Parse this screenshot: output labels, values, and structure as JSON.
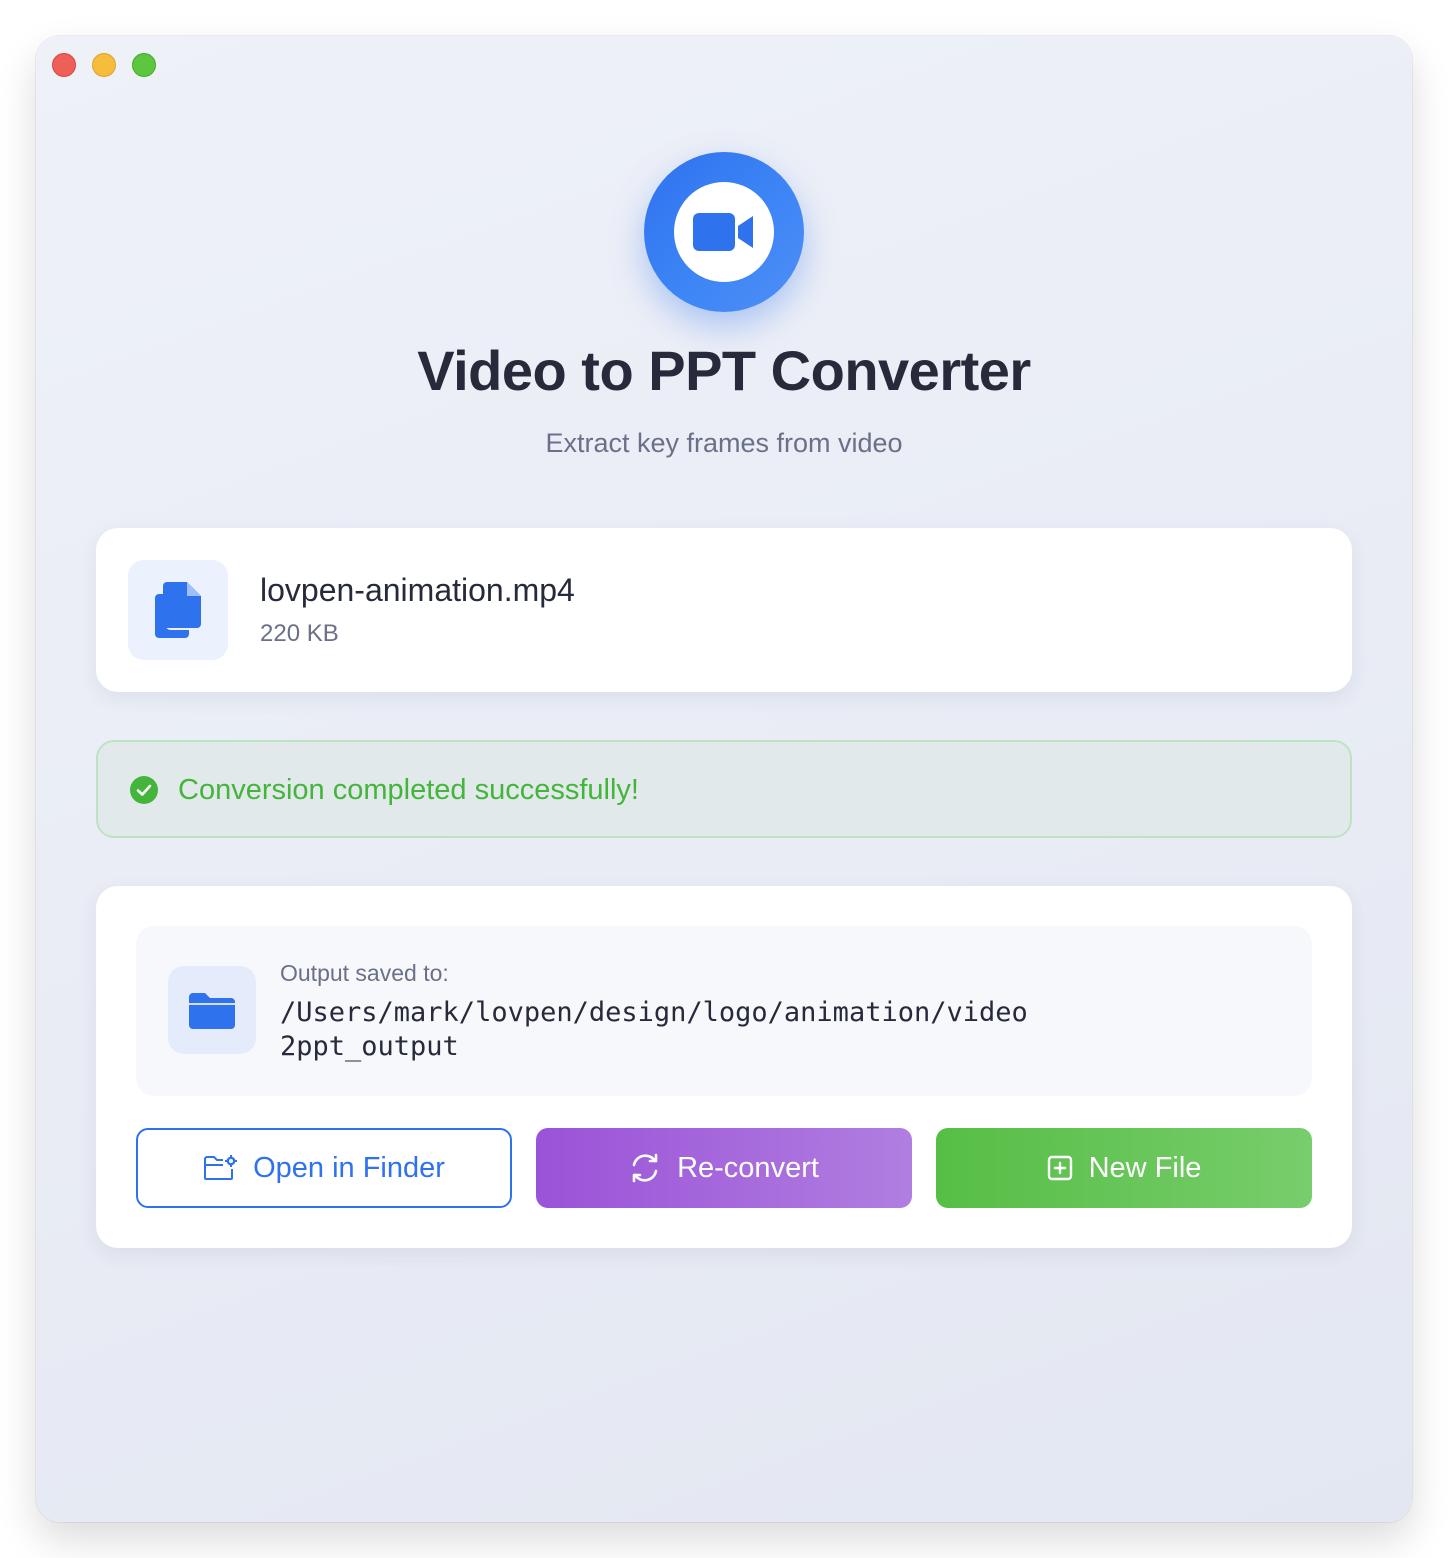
{
  "window": {
    "controls": [
      "close",
      "minimize",
      "maximize"
    ]
  },
  "header": {
    "logo_icon": "video-camera-icon",
    "title": "Video to PPT Converter",
    "subtitle": "Extract key frames from video"
  },
  "file": {
    "icon": "document-copy-icon",
    "name": "lovpen-animation.mp4",
    "size": "220 KB"
  },
  "status": {
    "icon": "check-circle-icon",
    "message": "Conversion completed successfully!",
    "color": "#43b53a"
  },
  "output": {
    "icon": "folder-icon",
    "label": "Output saved to:",
    "path": "/Users/mark/lovpen/design/logo/animation/video2ppt_output"
  },
  "actions": {
    "open_finder": {
      "label": "Open in Finder",
      "icon": "folder-settings-icon"
    },
    "reconvert": {
      "label": "Re-convert",
      "icon": "refresh-icon"
    },
    "new_file": {
      "label": "New File",
      "icon": "plus-square-icon"
    }
  },
  "colors": {
    "accent": "#2f72ee",
    "purple": "#9b52d7",
    "green": "#56be45",
    "text": "#262a3b",
    "muted": "#6b7089"
  }
}
